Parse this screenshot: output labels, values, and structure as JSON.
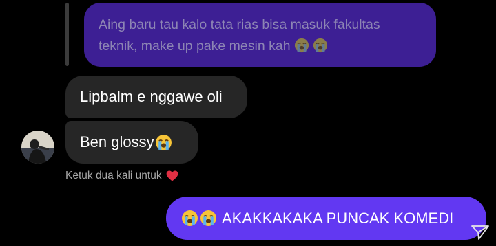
{
  "thread": {
    "reply_quote": {
      "text": "Aing baru tau kalo tata rias bisa masuk fakultas teknik, make up pake mesin kah"
    },
    "incoming": [
      {
        "text": "Lipbalm e nggawe oli"
      },
      {
        "text": "Ben glossy"
      }
    ],
    "like_hint": "Ketuk dua kali untuk",
    "outgoing": {
      "text": "AKAKKAKAKA PUNCAK KOMEDI"
    }
  },
  "icons": {
    "reply_emoji": "loudly-crying-face",
    "incoming_emoji": "loudly-crying-face",
    "outgoing_emoji": "loudly-crying-face",
    "hint_icon": "red-heart",
    "send_icon": "send-paper-plane"
  },
  "colors": {
    "background": "#000000",
    "reply_bubble": "#3d1f94",
    "incoming_bubble": "#262626",
    "outgoing_bubble": "#6238f2",
    "heart": "#e02f43"
  }
}
